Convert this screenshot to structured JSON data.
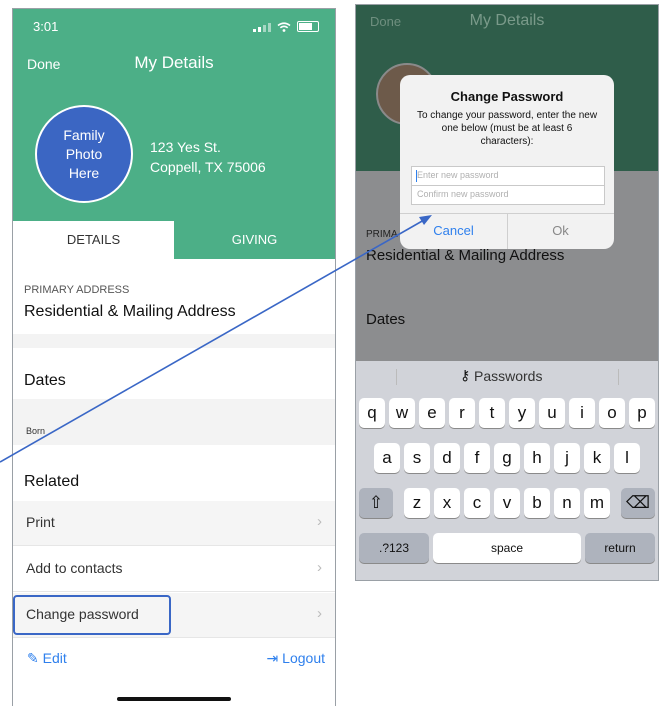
{
  "left_screen": {
    "status_time": "3:01",
    "nav": {
      "done": "Done",
      "title": "My Details"
    },
    "photo_placeholder": [
      "Family",
      "Photo",
      "Here"
    ],
    "address": {
      "line1": "123 Yes St.",
      "line2": "Coppell, TX 75006"
    },
    "tabs": [
      {
        "label": "DETAILS"
      },
      {
        "label": "GIVING"
      }
    ],
    "primary_address": {
      "label": "PRIMARY ADDRESS",
      "value": "Residential & Mailing Address"
    },
    "dates": {
      "title": "Dates",
      "born_label": "Born"
    },
    "related": {
      "title": "Related",
      "items": [
        {
          "label": "Print"
        },
        {
          "label": "Add to contacts"
        },
        {
          "label": "Change password"
        }
      ]
    },
    "footer": {
      "edit": "Edit",
      "logout": "Logout"
    },
    "colors": {
      "header": "#4caf87",
      "photo": "#3b66c3",
      "highlight": "#3a67c6",
      "link": "#2f80ed"
    }
  },
  "right_screen": {
    "nav": {
      "done": "Done",
      "title": "My Details"
    },
    "background": {
      "primary_partial": "PRIMA",
      "residential": "Residential & Mailing Address",
      "dates": "Dates"
    },
    "dialog": {
      "title": "Change Password",
      "message": "To change your password, enter the new one below (must be at least 6 characters):",
      "new_password_placeholder": "Enter new password",
      "confirm_password_placeholder": "Confirm new password",
      "cancel": "Cancel",
      "ok": "Ok"
    },
    "keyboard": {
      "suggestion": "Passwords",
      "row1": [
        "q",
        "w",
        "e",
        "r",
        "t",
        "y",
        "u",
        "i",
        "o",
        "p"
      ],
      "row2": [
        "a",
        "s",
        "d",
        "f",
        "g",
        "h",
        "j",
        "k",
        "l"
      ],
      "row3": [
        "z",
        "x",
        "c",
        "v",
        "b",
        "n",
        "m"
      ],
      "shift": "⇧",
      "backspace": "⌫",
      "numbers": ".?123",
      "space": "space",
      "return": "return"
    }
  }
}
